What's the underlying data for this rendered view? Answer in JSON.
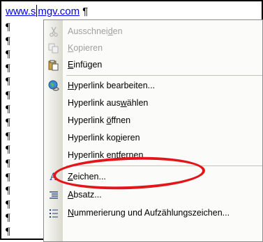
{
  "document": {
    "link_text_before": "www.s",
    "link_text_after": "mgv.com",
    "pilcrow": "¶",
    "pilcrow_rows": [
      "¶",
      "¶",
      "¶",
      "¶",
      "¶",
      "¶",
      "¶",
      "¶",
      "¶",
      "¶",
      "¶",
      "¶",
      "¶",
      "¶",
      "¶",
      "¶"
    ]
  },
  "menu": {
    "items": [
      {
        "pre": "Ausschnei",
        "acc": "d",
        "post": "en",
        "icon": "scissors-icon",
        "disabled": true
      },
      {
        "pre": "",
        "acc": "K",
        "post": "opieren",
        "icon": "copy-icon",
        "disabled": true
      },
      {
        "pre": "",
        "acc": "E",
        "post": "infügen",
        "icon": "paste-icon",
        "disabled": false
      },
      {
        "pre": "",
        "acc": "H",
        "post": "yperlink bearbeiten...",
        "icon": "hyperlink-globe-icon",
        "disabled": false
      },
      {
        "pre": "Hyperlink aus",
        "acc": "w",
        "post": "ählen",
        "icon": "",
        "disabled": false
      },
      {
        "pre": "Hyperlink ",
        "acc": "ö",
        "post": "ffnen",
        "icon": "",
        "disabled": false
      },
      {
        "pre": "Hyperlink ko",
        "acc": "p",
        "post": "ieren",
        "icon": "",
        "disabled": false
      },
      {
        "pre": "Hyperlink ",
        "acc": "e",
        "post": "ntfernen",
        "icon": "",
        "disabled": false
      },
      {
        "pre": "",
        "acc": "Z",
        "post": "eichen...",
        "icon": "font-a-icon",
        "disabled": false
      },
      {
        "pre": "",
        "acc": "A",
        "post": "bsatz...",
        "icon": "paragraph-icon",
        "disabled": false
      },
      {
        "pre": "",
        "acc": "N",
        "post": "ummerierung und Aufzählungszeichen...",
        "icon": "bullets-icon",
        "disabled": false
      }
    ]
  },
  "annotation": {
    "color": "#e3151a"
  }
}
